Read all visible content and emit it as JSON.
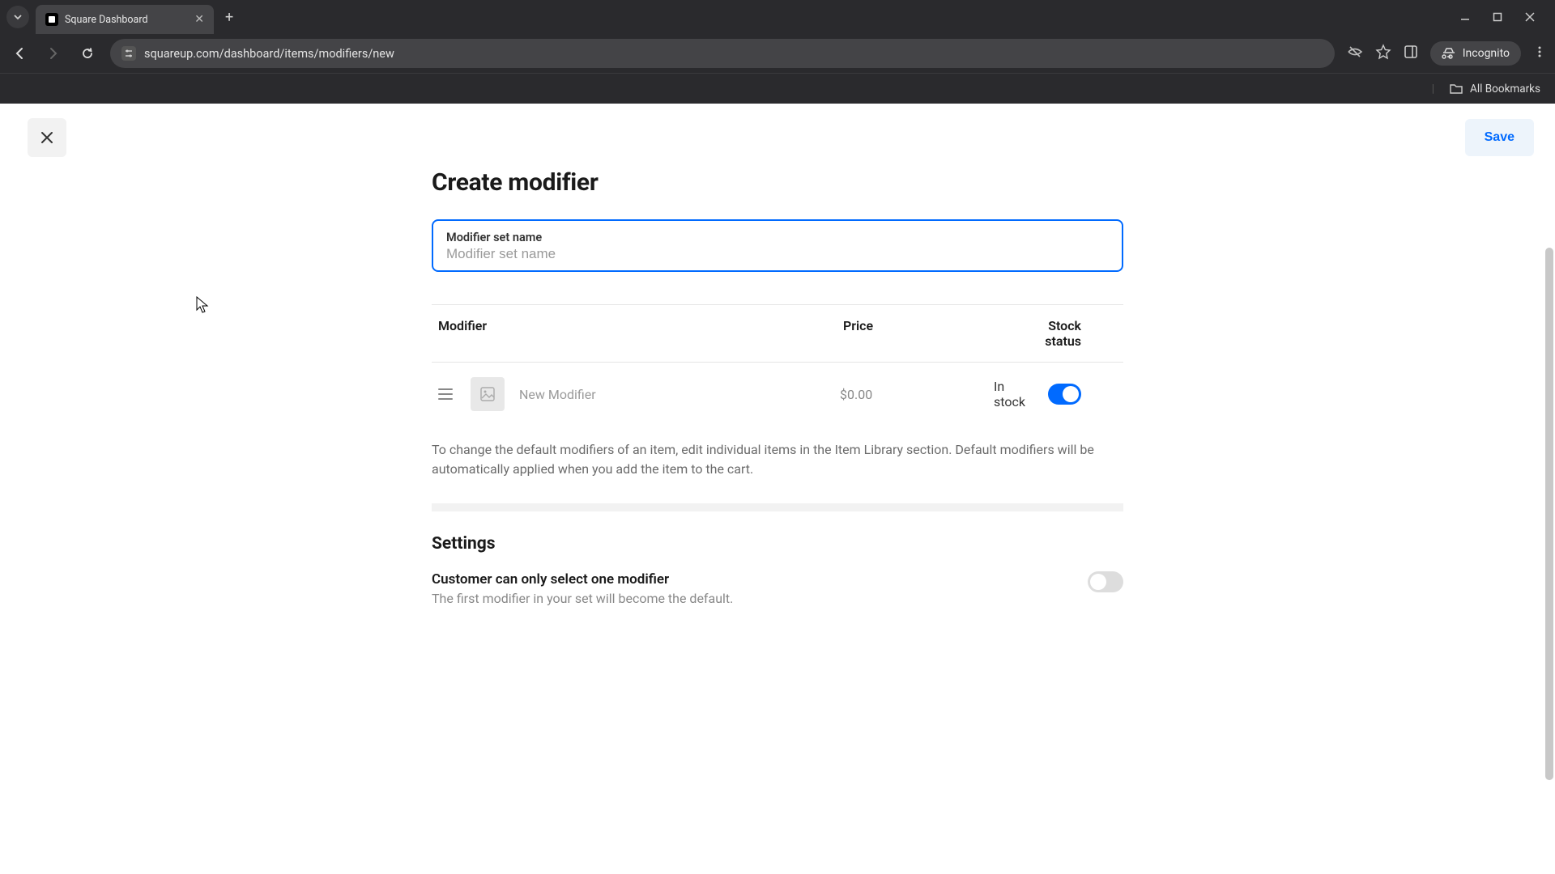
{
  "chrome": {
    "tab_title": "Square Dashboard",
    "url": "squareup.com/dashboard/items/modifiers/new",
    "incognito": "Incognito",
    "all_bookmarks": "All Bookmarks"
  },
  "header": {
    "save": "Save"
  },
  "page": {
    "title": "Create modifier",
    "input_label": "Modifier set name",
    "input_placeholder": "Modifier set name"
  },
  "table": {
    "headers": {
      "modifier": "Modifier",
      "price": "Price",
      "stock": "Stock status"
    },
    "rows": [
      {
        "name": "New Modifier",
        "price": "$0.00",
        "stock_label": "In stock",
        "stock_on": true
      }
    ]
  },
  "help_text": "To change the default modifiers of an item, edit individual items in the Item Library section. Default modifiers will be automatically applied when you add the item to the cart.",
  "settings": {
    "title": "Settings",
    "rows": [
      {
        "label": "Customer can only select one modifier",
        "desc": "The first modifier in your set will become the default.",
        "on": false
      }
    ]
  }
}
